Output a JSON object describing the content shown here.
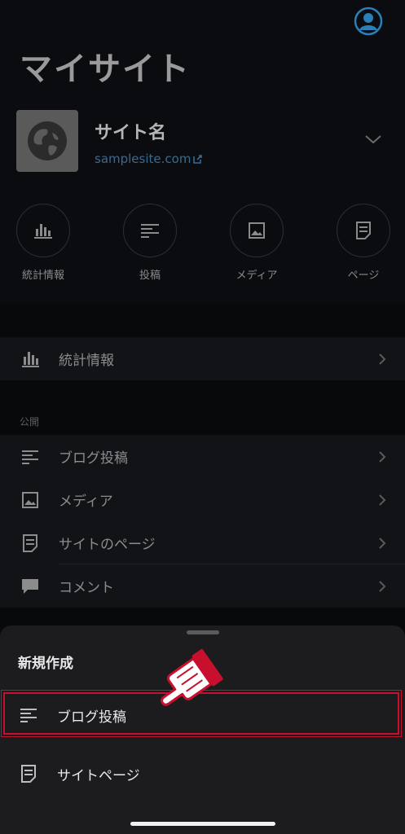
{
  "header": {
    "title": "マイサイト"
  },
  "site": {
    "name": "サイト名",
    "url": "samplesite.com"
  },
  "quick_actions": [
    {
      "label": "統計情報",
      "icon": "bar-chart-icon"
    },
    {
      "label": "投稿",
      "icon": "posts-icon"
    },
    {
      "label": "メディア",
      "icon": "image-icon"
    },
    {
      "label": "ページ",
      "icon": "page-icon"
    }
  ],
  "menu": {
    "stats": {
      "label": "統計情報"
    },
    "publish_section": "公開",
    "items": [
      {
        "label": "ブログ投稿",
        "icon": "posts-icon"
      },
      {
        "label": "メディア",
        "icon": "image-icon"
      },
      {
        "label": "サイトのページ",
        "icon": "page-icon"
      },
      {
        "label": "コメント",
        "icon": "comment-icon"
      }
    ]
  },
  "sheet": {
    "title": "新規作成",
    "items": [
      {
        "label": "ブログ投稿",
        "icon": "posts-icon"
      },
      {
        "label": "サイトページ",
        "icon": "page-icon"
      }
    ]
  },
  "colors": {
    "accent_link": "#3a6a90",
    "highlight": "#c8102e",
    "sheet_bg": "#1c1c1e"
  }
}
